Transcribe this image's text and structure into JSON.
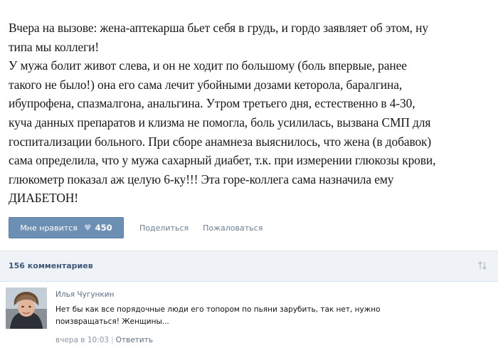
{
  "post": {
    "lines": [
      "Вчера на вызове: жена-аптекарша бьет себя в грудь, и гордо заявляет об этом, ну",
      "типа мы коллеги!",
      "У мужа болит живот слева, и он не ходит по большому (боль впервые, ранее",
      "такого не было!) она его сама лечит убойными дозами кеторола, баралгина,",
      "ибупрофена, спазмалгона, анальгина. Утром третьего дня, естественно в 4-30,",
      "куча данных препаратов и клизма не помогла, боль усилилась, вызвана СМП для",
      "госпитализации больного. При сборе анамнеза выяснилось, что жена (в добавок)",
      "сама определила, что у мужа сахарный диабет, т.к. при измерении глюкозы крови,",
      "глюкометр показал аж целую 6-ку!!! Эта горе-коллега сама назначила ему",
      "ДИАБЕТОН!"
    ]
  },
  "actions": {
    "like_label": "Мне нравится",
    "like_icon": "heart-icon",
    "like_count": "450",
    "share_label": "Поделиться",
    "report_label": "Пожаловаться"
  },
  "comments_header": {
    "count_label": "156 комментариев",
    "sort_icon": "sort-arrows-icon"
  },
  "comment": {
    "author": "Илья Чугункин",
    "text_lines": [
      "Нет бы как все порядочные люди его топором по пьяни зарубить, так нет, нужно",
      "поизвращаться! Женщины..."
    ],
    "time": "вчера в 10:03",
    "reply_label": "Ответить"
  },
  "colors": {
    "like_button_bg": "#6d8fb3",
    "link": "#6a7f95",
    "header_bg": "#eff2f6",
    "header_text": "#3d5a7a"
  }
}
